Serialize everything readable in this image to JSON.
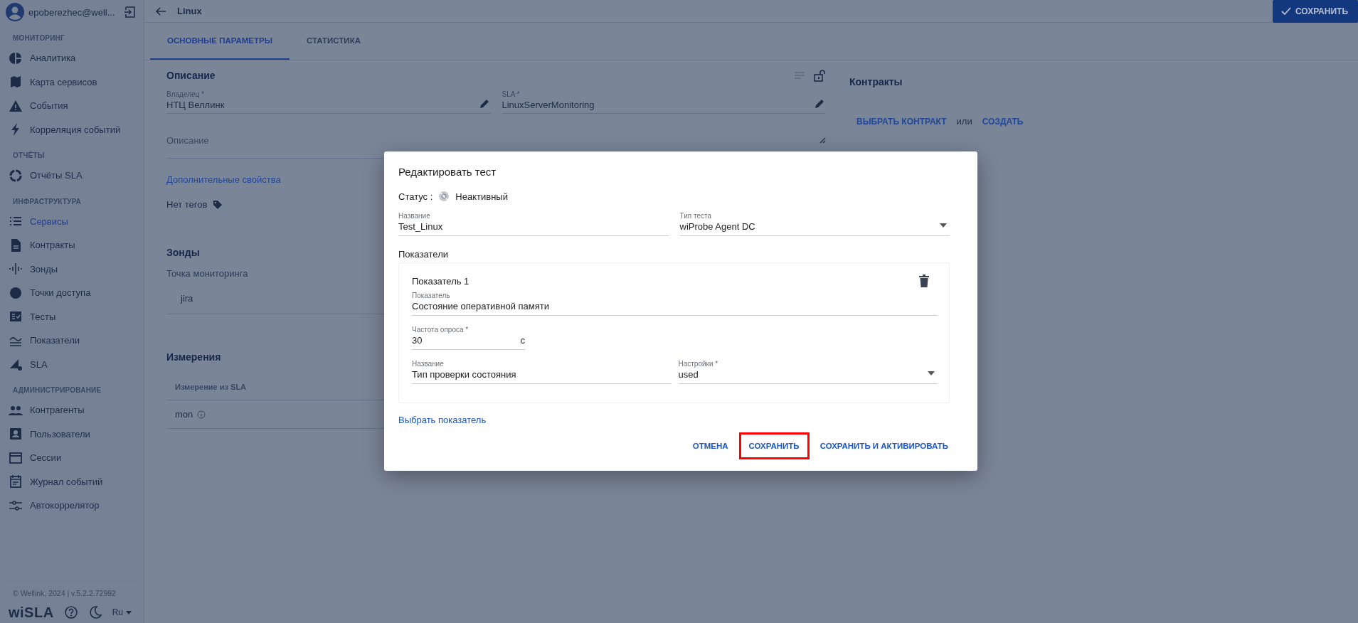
{
  "user": {
    "email": "epoberezhec@well..."
  },
  "sidebar": {
    "sections": [
      {
        "title": "МОНИТОРИНГ",
        "items": [
          {
            "label": "Аналитика",
            "selected": false
          },
          {
            "label": "Карта сервисов",
            "selected": false
          },
          {
            "label": "События",
            "selected": false
          },
          {
            "label": "Корреляция событий",
            "selected": false
          }
        ]
      },
      {
        "title": "ОТЧЁТЫ",
        "items": [
          {
            "label": "Отчёты SLA",
            "selected": false
          }
        ]
      },
      {
        "title": "ИНФРАСТРУКТУРА",
        "items": [
          {
            "label": "Сервисы",
            "selected": true
          },
          {
            "label": "Контракты",
            "selected": false
          },
          {
            "label": "Зонды",
            "selected": false
          },
          {
            "label": "Точки доступа",
            "selected": false
          },
          {
            "label": "Тесты",
            "selected": false
          },
          {
            "label": "Показатели",
            "selected": false
          },
          {
            "label": "SLA",
            "selected": false
          }
        ]
      },
      {
        "title": "АДМИНИСТРИРОВАНИЕ",
        "items": [
          {
            "label": "Контрагенты",
            "selected": false
          },
          {
            "label": "Пользователи",
            "selected": false
          },
          {
            "label": "Сессии",
            "selected": false
          },
          {
            "label": "Журнал событий",
            "selected": false
          },
          {
            "label": "Автокоррелятор",
            "selected": false
          }
        ]
      }
    ]
  },
  "footer": {
    "copyright": "© Wellink, 2024 | v.5.2.2.72992",
    "logo": "wiSLA",
    "language": "Ru"
  },
  "header": {
    "title": "Linux",
    "save_button": "СОХРАНИТЬ"
  },
  "tabs": [
    {
      "label": "ОСНОВНЫЕ ПАРАМЕТРЫ",
      "selected": true
    },
    {
      "label": "СТАТИСТИКА",
      "selected": false
    }
  ],
  "description": {
    "title": "Описание",
    "fields": [
      {
        "label": "Владелец *",
        "value": "НТЦ Веллинк"
      },
      {
        "label": "SLA *",
        "value": "LinuxServerMonitoring"
      }
    ],
    "placeholder": "Описание",
    "extra_link": "Дополнительные свойства",
    "tags": "Нет тегов"
  },
  "probes": {
    "title": "Зонды",
    "subtitle": "Точка мониторинга",
    "items": [
      "jira"
    ]
  },
  "measurements": {
    "title": "Измерения",
    "column": "Измерение из SLA",
    "rows": [
      "mon"
    ]
  },
  "contracts": {
    "title": "Контракты",
    "choose": "ВЫБРАТЬ КОНТРАКТ",
    "or": "или",
    "create": "СОЗДАТЬ"
  },
  "dialog": {
    "title": "Редактировать тест",
    "status_label": "Статус :",
    "status": "Неактивный",
    "name": {
      "label": "Название",
      "value": "Test_Linux"
    },
    "test_type": {
      "label": "Тип теста",
      "value": "wiProbe Agent DC"
    },
    "metrics_title": "Показатели",
    "metrics": [
      {
        "title": "Показатель 1",
        "metric": {
          "label": "Показатель",
          "value": "Состояние оперативной памяти"
        },
        "frequency": {
          "label": "Частота опроса *",
          "value": "30",
          "unit": "с"
        },
        "param": {
          "label": "Название",
          "value": "Тип проверки состояния"
        },
        "settings": {
          "label": "Настройки *",
          "value": "used"
        }
      }
    ],
    "choose_metric": "Выбрать показатель",
    "actions": [
      {
        "label": "ОТМЕНА",
        "highlighted": false
      },
      {
        "label": "СОХРАНИТЬ",
        "highlighted": true
      },
      {
        "label": "СОХРАНИТЬ И АКТИВИРОВАТЬ",
        "highlighted": false
      }
    ]
  }
}
